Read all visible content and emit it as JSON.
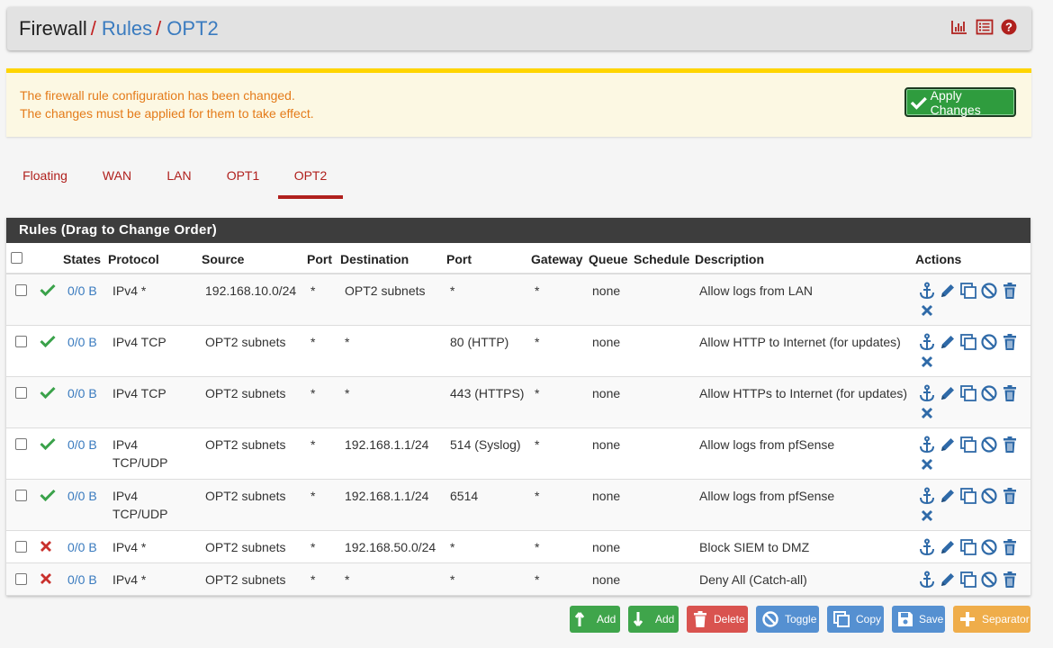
{
  "breadcrumb": [
    "Firewall",
    "Rules",
    "OPT2"
  ],
  "header_icons": [
    "chart-icon",
    "list-icon",
    "help-icon"
  ],
  "alert": {
    "line1": "The firewall rule configuration has been changed.",
    "line2": "The changes must be applied for them to take effect.",
    "apply_label": "Apply Changes"
  },
  "tabs": [
    "Floating",
    "WAN",
    "LAN",
    "OPT1",
    "OPT2"
  ],
  "active_tab": "OPT2",
  "panel_title": "Rules (Drag to Change Order)",
  "columns": [
    "States",
    "Protocol",
    "Source",
    "Port",
    "Destination",
    "Port",
    "Gateway",
    "Queue",
    "Schedule",
    "Description",
    "Actions"
  ],
  "rules": [
    {
      "status": "pass",
      "states": "0/0 B",
      "protocol": "IPv4 *",
      "source": "192.168.10.0/24",
      "sport": "*",
      "destination": "OPT2 subnets",
      "dport": "*",
      "gateway": "*",
      "queue": "none",
      "schedule": "",
      "description": "Allow logs from LAN"
    },
    {
      "status": "pass",
      "states": "0/0 B",
      "protocol": "IPv4 TCP",
      "source": "OPT2 subnets",
      "sport": "*",
      "destination": "*",
      "dport": "80 (HTTP)",
      "gateway": "*",
      "queue": "none",
      "schedule": "",
      "description": "Allow HTTP to Internet (for updates)"
    },
    {
      "status": "pass",
      "states": "0/0 B",
      "protocol": "IPv4 TCP",
      "source": "OPT2 subnets",
      "sport": "*",
      "destination": "*",
      "dport": "443 (HTTPS)",
      "gateway": "*",
      "queue": "none",
      "schedule": "",
      "description": "Allow HTTPs to Internet (for updates)"
    },
    {
      "status": "pass",
      "states": "0/0 B",
      "protocol": "IPv4 TCP/UDP",
      "source": "OPT2 subnets",
      "sport": "*",
      "destination": "192.168.1.1/24",
      "dport": "514 (Syslog)",
      "gateway": "*",
      "queue": "none",
      "schedule": "",
      "description": "Allow logs from pfSense"
    },
    {
      "status": "pass",
      "states": "0/0 B",
      "protocol": "IPv4 TCP/UDP",
      "source": "OPT2 subnets",
      "sport": "*",
      "destination": "192.168.1.1/24",
      "dport": "6514",
      "gateway": "*",
      "queue": "none",
      "schedule": "",
      "description": "Allow logs from pfSense"
    },
    {
      "status": "block",
      "states": "0/0 B",
      "protocol": "IPv4 *",
      "source": "OPT2 subnets",
      "sport": "*",
      "destination": "192.168.50.0/24",
      "dport": "*",
      "gateway": "*",
      "queue": "none",
      "schedule": "",
      "description": "Block SIEM to DMZ"
    },
    {
      "status": "block",
      "states": "0/0 B",
      "protocol": "IPv4 *",
      "source": "OPT2 subnets",
      "sport": "*",
      "destination": "*",
      "dport": "*",
      "gateway": "*",
      "queue": "none",
      "schedule": "",
      "description": "Deny All (Catch-all)"
    }
  ],
  "buttons": [
    {
      "label": "Add",
      "icon": "arrow-up-icon",
      "color": "#3fa54b"
    },
    {
      "label": "Add",
      "icon": "arrow-down-icon",
      "color": "#3fa54b"
    },
    {
      "label": "Delete",
      "icon": "trash-icon",
      "color": "#d9534f"
    },
    {
      "label": "Toggle",
      "icon": "ban-icon",
      "color": "#5590d1"
    },
    {
      "label": "Copy",
      "icon": "copy-icon",
      "color": "#5590d1"
    },
    {
      "label": "Save",
      "icon": "save-icon",
      "color": "#5590d1"
    },
    {
      "label": "Separator",
      "icon": "plus-icon",
      "color": "#efad4a"
    }
  ],
  "colors": {
    "accent": "#b0201d",
    "link": "#3a7bbf",
    "pass": "#3aa24a",
    "block": "#c9302c",
    "action": "#2f6aa8"
  }
}
